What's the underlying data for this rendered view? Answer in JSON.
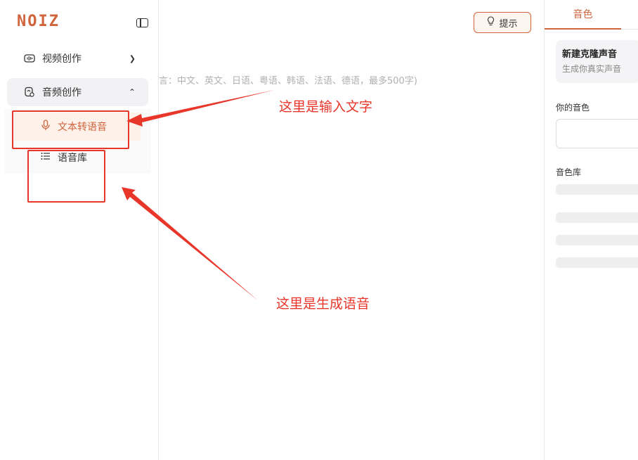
{
  "sidebar": {
    "logo": "NOIZ",
    "nav": [
      {
        "label": "视频创作",
        "icon": "video-wave-icon",
        "expanded": false
      },
      {
        "label": "音频创作",
        "icon": "audio-icon",
        "expanded": true
      }
    ],
    "submenu": [
      {
        "label": "文本转语音",
        "icon": "microphone-icon",
        "active": true
      },
      {
        "label": "语音库",
        "icon": "list-icon",
        "active": false
      }
    ]
  },
  "main": {
    "tip_label": "提示",
    "placeholder": "言：中文、英文、日语、粤语、韩语、法语、德语，最多500字)"
  },
  "right_panel": {
    "tab_label": "音色",
    "clone_title": "新建克隆声音",
    "clone_subtitle": "生成你真实声音",
    "my_voice_label": "你的音色",
    "library_label": "音色库"
  },
  "annotations": {
    "input_text": "这里是输入文字",
    "generate_text": "这里是生成语音"
  },
  "colors": {
    "brand": "#d0643c",
    "annotation": "#e8362a"
  }
}
